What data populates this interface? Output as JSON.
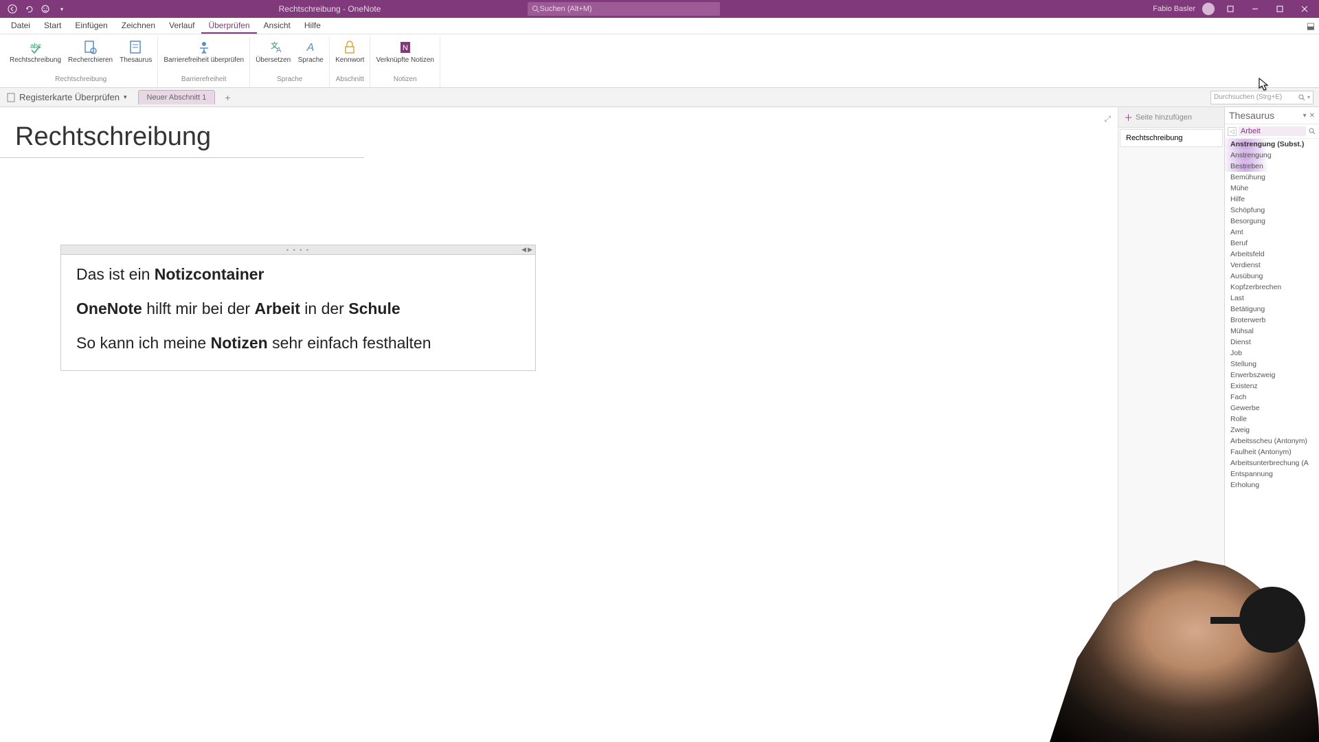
{
  "titlebar": {
    "doc_title": "Rechtschreibung  -  OneNote",
    "search_placeholder": "Suchen (Alt+M)",
    "user_name": "Fabio Basler"
  },
  "menu": {
    "items": [
      "Datei",
      "Start",
      "Einfügen",
      "Zeichnen",
      "Verlauf",
      "Überprüfen",
      "Ansicht",
      "Hilfe"
    ],
    "active_index": 5
  },
  "ribbon": {
    "groups": [
      {
        "label": "Rechtschreibung",
        "buttons": [
          "Rechtschreibung",
          "Recherchieren",
          "Thesaurus"
        ]
      },
      {
        "label": "Barrierefreiheit",
        "buttons": [
          "Barrierefreiheit überprüfen"
        ]
      },
      {
        "label": "Sprache",
        "buttons": [
          "Übersetzen",
          "Sprache"
        ]
      },
      {
        "label": "Abschnitt",
        "buttons": [
          "Kennwort"
        ]
      },
      {
        "label": "Notizen",
        "buttons": [
          "Verknüpfte Notizen"
        ]
      }
    ]
  },
  "notebook": {
    "name": "Registerkarte Überprüfen",
    "section_tab": "Neuer Abschnitt 1",
    "search_placeholder": "Durchsuchen (Strg+E)"
  },
  "page": {
    "title": "Rechtschreibung",
    "add_page": "Seite hinzufügen",
    "page_item": "Rechtschreibung"
  },
  "note": {
    "line1_prefix": "Das ist ein ",
    "line1_bold": "Notizcontainer",
    "line2_b1": "OneNote",
    "line2_mid1": " hilft mir bei der ",
    "line2_b2": "Arbeit",
    "line2_mid2": " in der ",
    "line2_b3": "Schule",
    "line3_pre": "So kann ich meine ",
    "line3_bold": "Notizen",
    "line3_post": " sehr einfach festhalten"
  },
  "thesaurus": {
    "title": "Thesaurus",
    "search_term": "Arbeit",
    "results": [
      {
        "text": "Anstrengung (Subst.)",
        "header": true
      },
      {
        "text": "Anstrengung"
      },
      {
        "text": "Bestreben"
      },
      {
        "text": "Bemühung"
      },
      {
        "text": "Mühe"
      },
      {
        "text": "Hilfe"
      },
      {
        "text": "Schöpfung"
      },
      {
        "text": "Besorgung"
      },
      {
        "text": "Amt"
      },
      {
        "text": "Beruf"
      },
      {
        "text": "Arbeitsfeld"
      },
      {
        "text": "Verdienst"
      },
      {
        "text": "Ausübung"
      },
      {
        "text": "Kopfzerbrechen"
      },
      {
        "text": "Last"
      },
      {
        "text": "Betätigung"
      },
      {
        "text": "Broterwerb"
      },
      {
        "text": "Mühsal"
      },
      {
        "text": "Dienst"
      },
      {
        "text": "Job"
      },
      {
        "text": "Stellung"
      },
      {
        "text": "Erwerbszweig"
      },
      {
        "text": "Existenz"
      },
      {
        "text": "Fach"
      },
      {
        "text": "Gewerbe"
      },
      {
        "text": "Rolle"
      },
      {
        "text": "Zweig"
      },
      {
        "text": "Arbeitsscheu (Antonym)"
      },
      {
        "text": "Faulheit (Antonym)"
      },
      {
        "text": "Arbeitsunterbrechung (A"
      },
      {
        "text": "Entspannung"
      },
      {
        "text": "Erholung"
      }
    ]
  }
}
